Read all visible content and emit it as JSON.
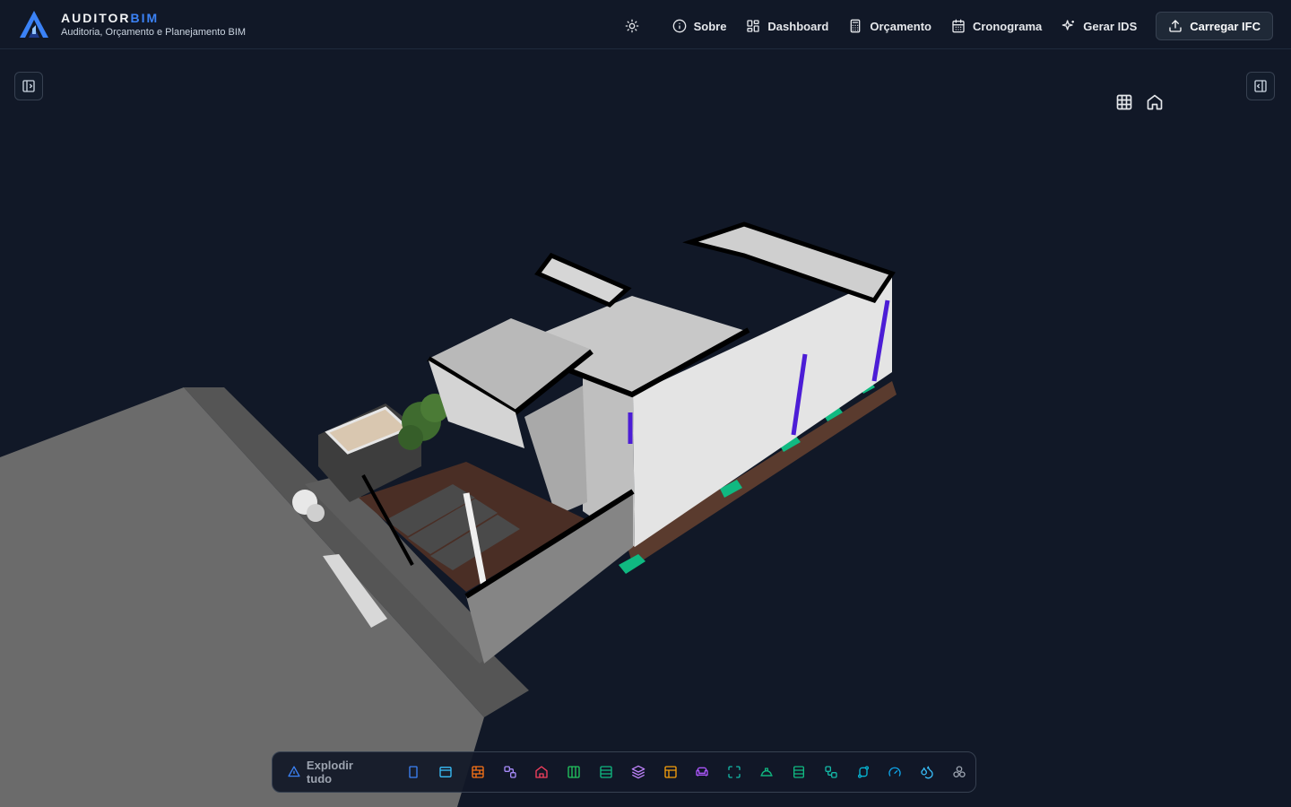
{
  "brand": {
    "name_main": "AUDITOR",
    "name_accent": "BIM",
    "subtitle": "Auditoria, Orçamento e Planejamento BIM"
  },
  "nav": {
    "theme_icon": "sun-icon",
    "items": [
      {
        "label": "Sobre",
        "icon": "info-icon"
      },
      {
        "label": "Dashboard",
        "icon": "dashboard-icon"
      },
      {
        "label": "Orçamento",
        "icon": "calculator-icon"
      },
      {
        "label": "Cronograma",
        "icon": "calendar-icon"
      },
      {
        "label": "Gerar IDS",
        "icon": "sparkles-icon"
      }
    ],
    "upload_label": "Carregar IFC"
  },
  "toolbar": {
    "explode_label": "Explodir tudo",
    "tools": [
      {
        "icon": "door-icon",
        "color": "#3b82f6"
      },
      {
        "icon": "window-icon",
        "color": "#38bdf8"
      },
      {
        "icon": "wall-icon",
        "color": "#f97316"
      },
      {
        "icon": "link-icon",
        "color": "#a78bfa"
      },
      {
        "icon": "roof-icon",
        "color": "#f43f5e"
      },
      {
        "icon": "column-icon",
        "color": "#22c55e"
      },
      {
        "icon": "slab-icon",
        "color": "#10b981"
      },
      {
        "icon": "layers-icon",
        "color": "#c084fc"
      },
      {
        "icon": "panel-icon",
        "color": "#f59e0b"
      },
      {
        "icon": "furniture-icon",
        "color": "#a855f7"
      },
      {
        "icon": "space-icon",
        "color": "#14b8a6"
      },
      {
        "icon": "stairs-icon",
        "color": "#10b981"
      },
      {
        "icon": "beam-icon",
        "color": "#10b981"
      },
      {
        "icon": "pipe-icon",
        "color": "#14b8a6"
      },
      {
        "icon": "route-icon",
        "color": "#06b6d4"
      },
      {
        "icon": "gauge-icon",
        "color": "#0ea5e9"
      },
      {
        "icon": "drops-icon",
        "color": "#38bdf8"
      },
      {
        "icon": "cluster-icon",
        "color": "#9ca3af"
      }
    ]
  }
}
